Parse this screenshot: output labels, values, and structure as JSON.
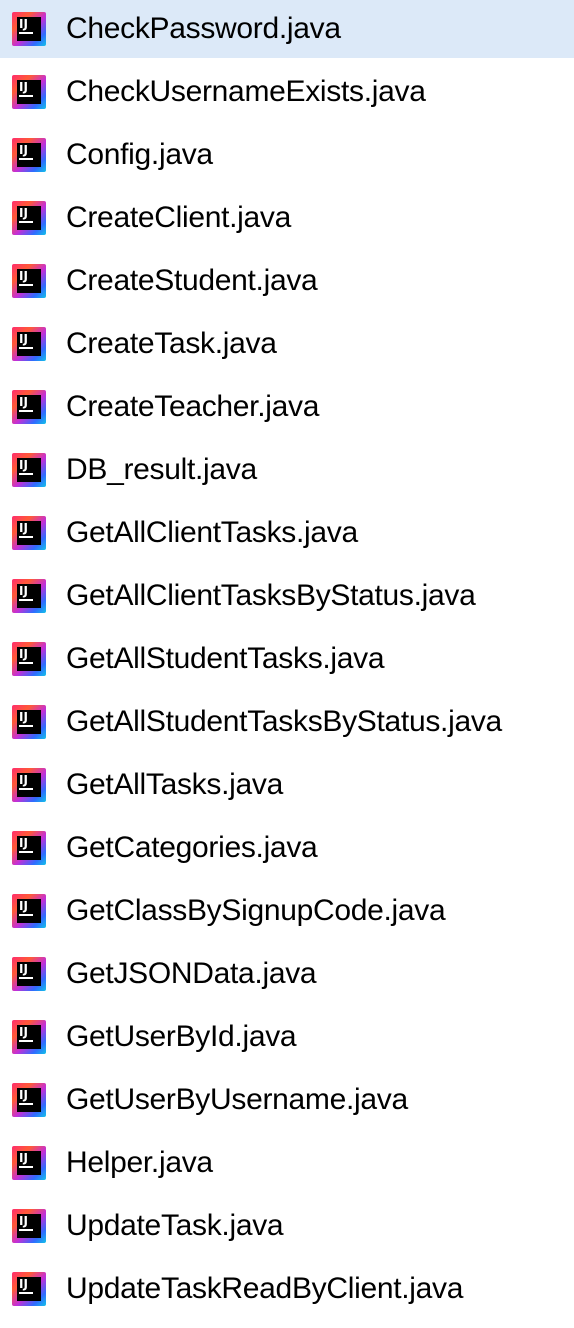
{
  "files": [
    {
      "name": "CheckPassword.java",
      "icon": "intellij-java-file-icon",
      "selected": true
    },
    {
      "name": "CheckUsernameExists.java",
      "icon": "intellij-java-file-icon",
      "selected": false
    },
    {
      "name": "Config.java",
      "icon": "intellij-java-file-icon",
      "selected": false
    },
    {
      "name": "CreateClient.java",
      "icon": "intellij-java-file-icon",
      "selected": false
    },
    {
      "name": "CreateStudent.java",
      "icon": "intellij-java-file-icon",
      "selected": false
    },
    {
      "name": "CreateTask.java",
      "icon": "intellij-java-file-icon",
      "selected": false
    },
    {
      "name": "CreateTeacher.java",
      "icon": "intellij-java-file-icon",
      "selected": false
    },
    {
      "name": "DB_result.java",
      "icon": "intellij-java-file-icon",
      "selected": false
    },
    {
      "name": "GetAllClientTasks.java",
      "icon": "intellij-java-file-icon",
      "selected": false
    },
    {
      "name": "GetAllClientTasksByStatus.java",
      "icon": "intellij-java-file-icon",
      "selected": false
    },
    {
      "name": "GetAllStudentTasks.java",
      "icon": "intellij-java-file-icon",
      "selected": false
    },
    {
      "name": "GetAllStudentTasksByStatus.java",
      "icon": "intellij-java-file-icon",
      "selected": false
    },
    {
      "name": "GetAllTasks.java",
      "icon": "intellij-java-file-icon",
      "selected": false
    },
    {
      "name": "GetCategories.java",
      "icon": "intellij-java-file-icon",
      "selected": false
    },
    {
      "name": "GetClassBySignupCode.java",
      "icon": "intellij-java-file-icon",
      "selected": false
    },
    {
      "name": "GetJSONData.java",
      "icon": "intellij-java-file-icon",
      "selected": false
    },
    {
      "name": "GetUserById.java",
      "icon": "intellij-java-file-icon",
      "selected": false
    },
    {
      "name": "GetUserByUsername.java",
      "icon": "intellij-java-file-icon",
      "selected": false
    },
    {
      "name": "Helper.java",
      "icon": "intellij-java-file-icon",
      "selected": false
    },
    {
      "name": "UpdateTask.java",
      "icon": "intellij-java-file-icon",
      "selected": false
    },
    {
      "name": "UpdateTaskReadByClient.java",
      "icon": "intellij-java-file-icon",
      "selected": false
    }
  ],
  "colors": {
    "selection_background": "#dce9f8",
    "text": "#000000",
    "background": "#ffffff"
  }
}
